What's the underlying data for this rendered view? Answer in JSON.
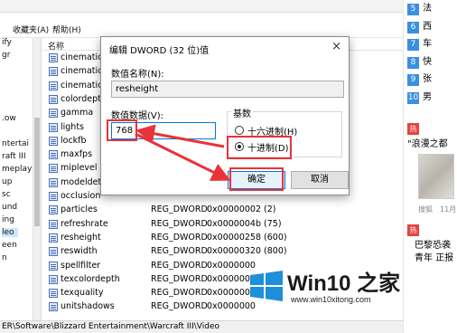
{
  "menu": {
    "topstrip_items": [
      "",
      "",
      "",
      ""
    ],
    "favorites": "收藏夹(A)",
    "help": "帮助(H)"
  },
  "tree": {
    "items": [
      "ify",
      "gr",
      "",
      "",
      "",
      ".ow",
      "",
      "ntertai",
      "raft III",
      "meplay",
      "up",
      "sc",
      "und",
      "ing",
      "leo",
      "een",
      "n"
    ],
    "selected_index": 14
  },
  "list": {
    "column_name": "名称",
    "rows": [
      {
        "name": "cinematicov",
        "type": "",
        "data": ""
      },
      {
        "name": "cinematicref",
        "type": "",
        "data": ""
      },
      {
        "name": "cinematicwi",
        "type": "",
        "data": ""
      },
      {
        "name": "colordepth",
        "type": "",
        "data": ""
      },
      {
        "name": "gamma",
        "type": "",
        "data": ""
      },
      {
        "name": "lights",
        "type": "",
        "data": ""
      },
      {
        "name": "lockfb",
        "type": "",
        "data": ""
      },
      {
        "name": "maxfps",
        "type": "",
        "data": ""
      },
      {
        "name": "miplevel",
        "type": "",
        "data": ""
      },
      {
        "name": "modeldetail",
        "type": "",
        "data": ""
      },
      {
        "name": "occlusion",
        "type": "",
        "data": ""
      },
      {
        "name": "particles",
        "type": "REG_DWORD",
        "data": "0x00000002 (2)"
      },
      {
        "name": "refreshrate",
        "type": "REG_DWORD",
        "data": "0x0000004b (75)"
      },
      {
        "name": "resheight",
        "type": "REG_DWORD",
        "data": "0x00000258 (600)"
      },
      {
        "name": "reswidth",
        "type": "REG_DWORD",
        "data": "0x00000320 (800)"
      },
      {
        "name": "spellfilter",
        "type": "REG_DWORD",
        "data": "0x0000000"
      },
      {
        "name": "texcolordepth",
        "type": "REG_DWORD",
        "data": "0x0000001"
      },
      {
        "name": "texquality",
        "type": "REG_DWORD",
        "data": "0x0000000"
      },
      {
        "name": "unitshadows",
        "type": "REG_DWORD",
        "data": "0x0000000"
      }
    ]
  },
  "statusbar": {
    "path": "ER\\Software\\Blizzard Entertainment\\Warcraft III\\Video"
  },
  "dialog": {
    "title": "编辑 DWORD (32 位)值",
    "close_glyph": "×",
    "value_name_label": "数值名称(N):",
    "value_name": "resheight",
    "value_data_label": "数值数据(V):",
    "value_data": "768",
    "base_label": "基数",
    "hex_option": "十六进制(H)",
    "dec_option": "十进制(D)",
    "selected_base": "decimal",
    "ok": "确定",
    "cancel": "取消"
  },
  "news": {
    "items": [
      {
        "num": "5",
        "text": "法"
      },
      {
        "num": "6",
        "text": "西"
      },
      {
        "num": "7",
        "text": "车"
      },
      {
        "num": "8",
        "text": "快"
      },
      {
        "num": "9",
        "text": "张"
      },
      {
        "num": "10",
        "text": "男"
      }
    ],
    "hot_badge": "热",
    "story1": "\"浪漫之都",
    "meta_source": "搜狐",
    "meta_date": "11月",
    "story2_line1": "巴黎恐袭",
    "story2_line2": "青年 正报"
  },
  "watermark": {
    "title": "Win10 之家",
    "url": "www.win10xitong.com"
  },
  "colors": {
    "accent": "#0078d7",
    "annotation_red": "#e8333b",
    "win_blue": "#1e8fd9"
  }
}
